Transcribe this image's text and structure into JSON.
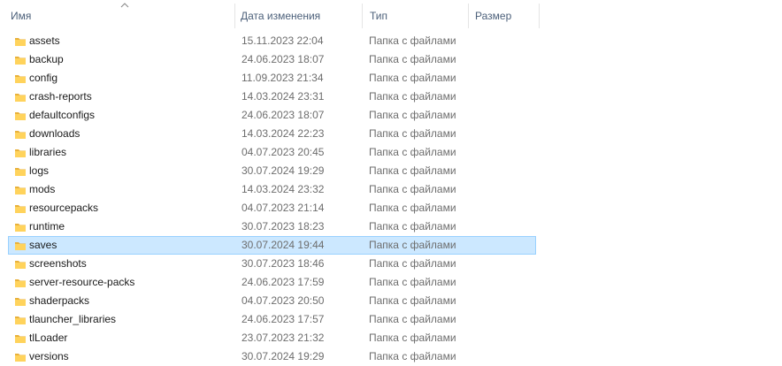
{
  "columns": {
    "name": "Имя",
    "date": "Дата изменения",
    "type": "Тип",
    "size": "Размер"
  },
  "files": [
    {
      "name": "assets",
      "date": "15.11.2023 22:04",
      "type": "Папка с файлами"
    },
    {
      "name": "backup",
      "date": "24.06.2023 18:07",
      "type": "Папка с файлами"
    },
    {
      "name": "config",
      "date": "11.09.2023 21:34",
      "type": "Папка с файлами"
    },
    {
      "name": "crash-reports",
      "date": "14.03.2024 23:31",
      "type": "Папка с файлами"
    },
    {
      "name": "defaultconfigs",
      "date": "24.06.2023 18:07",
      "type": "Папка с файлами"
    },
    {
      "name": "downloads",
      "date": "14.03.2024 22:23",
      "type": "Папка с файлами"
    },
    {
      "name": "libraries",
      "date": "04.07.2023 20:45",
      "type": "Папка с файлами"
    },
    {
      "name": "logs",
      "date": "30.07.2024 19:29",
      "type": "Папка с файлами"
    },
    {
      "name": "mods",
      "date": "14.03.2024 23:32",
      "type": "Папка с файлами"
    },
    {
      "name": "resourcepacks",
      "date": "04.07.2023 21:14",
      "type": "Папка с файлами"
    },
    {
      "name": "runtime",
      "date": "30.07.2023 18:23",
      "type": "Папка с файлами"
    },
    {
      "name": "saves",
      "date": "30.07.2024 19:44",
      "type": "Папка с файлами",
      "selected": true
    },
    {
      "name": "screenshots",
      "date": "30.07.2023 18:46",
      "type": "Папка с файлами"
    },
    {
      "name": "server-resource-packs",
      "date": "24.06.2023 17:59",
      "type": "Папка с файлами"
    },
    {
      "name": "shaderpacks",
      "date": "04.07.2023 20:50",
      "type": "Папка с файлами"
    },
    {
      "name": "tlauncher_libraries",
      "date": "24.06.2023 17:57",
      "type": "Папка с файлами"
    },
    {
      "name": "tlLoader",
      "date": "23.07.2023 21:32",
      "type": "Папка с файлами"
    },
    {
      "name": "versions",
      "date": "30.07.2024 19:29",
      "type": "Папка с файлами"
    }
  ],
  "icons": {
    "folder": "folder-icon",
    "sort": "sort-ascending-icon"
  },
  "colors": {
    "selection_bg": "#cce8ff",
    "selection_border": "#99d1ff",
    "header_text": "#4c607a",
    "folder_body": "#ffd35c",
    "folder_tab": "#e8b13b"
  }
}
